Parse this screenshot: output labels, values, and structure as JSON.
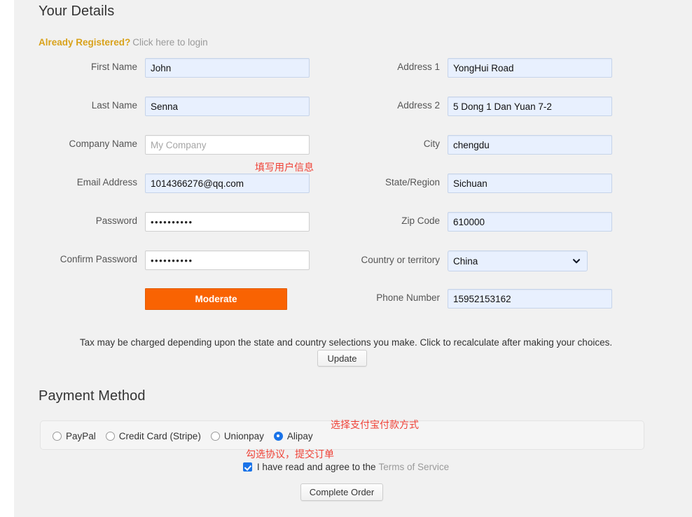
{
  "sections": {
    "details_title": "Your Details",
    "payment_title": "Payment Method"
  },
  "already_registered": {
    "strong": "Already Registered?",
    "link": "Click here to login"
  },
  "left_fields": [
    {
      "label": "First Name",
      "value": "John",
      "placeholder": "",
      "autofill": true,
      "password": false
    },
    {
      "label": "Last Name",
      "value": "Senna",
      "placeholder": "",
      "autofill": true,
      "password": false
    },
    {
      "label": "Company Name",
      "value": "",
      "placeholder": "My Company",
      "autofill": false,
      "password": false
    },
    {
      "label": "Email Address",
      "value": "1014366276@qq.com",
      "placeholder": "",
      "autofill": true,
      "password": false
    },
    {
      "label": "Password",
      "value": "••••••••••",
      "placeholder": "",
      "autofill": false,
      "password": true
    },
    {
      "label": "Confirm Password",
      "value": "••••••••••",
      "placeholder": "",
      "autofill": false,
      "password": true
    }
  ],
  "right_fields": [
    {
      "label": "Address 1",
      "value": "YongHui Road",
      "autofill": true
    },
    {
      "label": "Address 2",
      "value": "5 Dong 1 Dan Yuan 7-2",
      "autofill": true
    },
    {
      "label": "City",
      "value": "chengdu",
      "autofill": true
    },
    {
      "label": "State/Region",
      "value": "Sichuan",
      "autofill": true
    },
    {
      "label": "Zip Code",
      "value": "610000",
      "autofill": true
    }
  ],
  "country": {
    "label": "Country or territory",
    "value": "China",
    "options": [
      "China"
    ],
    "icon": "chevron-down-icon"
  },
  "phone": {
    "label": "Phone Number",
    "value": "15952153162"
  },
  "moderate_button": {
    "label": "Moderate",
    "color": "#f96302"
  },
  "tax": {
    "note": "Tax may be charged depending upon the state and country selections you make. Click to recalculate after making your choices.",
    "update_label": "Update"
  },
  "payment_methods": [
    {
      "label": "PayPal",
      "checked": false
    },
    {
      "label": "Credit Card (Stripe)",
      "checked": false
    },
    {
      "label": "Unionpay",
      "checked": false
    },
    {
      "label": "Alipay",
      "checked": true
    }
  ],
  "terms": {
    "text": "I have read and agree to the",
    "link": "Terms of Service",
    "checked": true
  },
  "complete_order": {
    "label": "Complete Order"
  },
  "annotations": {
    "fill_user_info": "填写用户信息",
    "select_alipay": "选择支付宝付款方式",
    "check_terms": "勾选协议，提交订单",
    "color": "#ef4136"
  }
}
